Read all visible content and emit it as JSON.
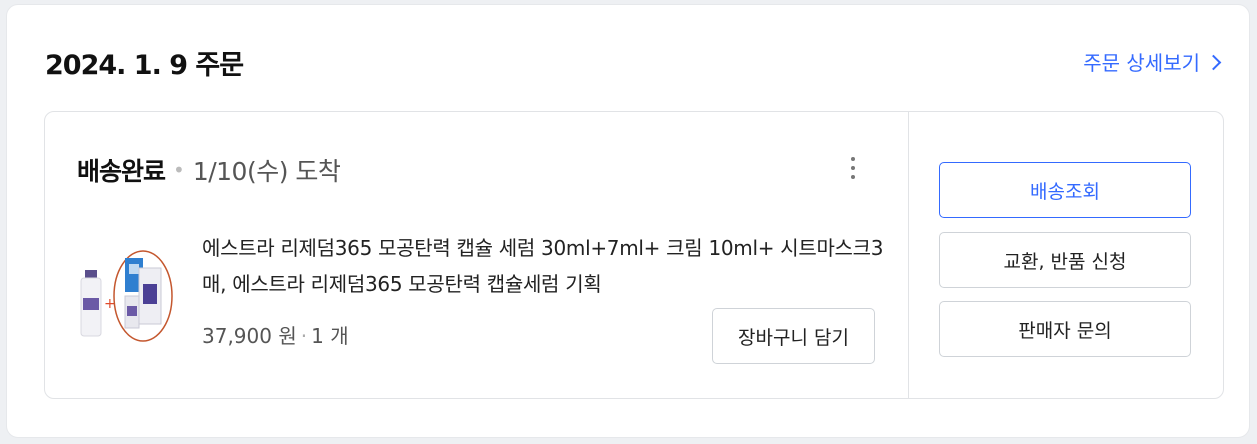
{
  "order": {
    "date_title": "2024. 1. 9 주문",
    "detail_link": "주문 상세보기",
    "status": "배송완료",
    "arrival": "1/10(수) 도착",
    "product": {
      "name": "에스트라 리제덤365 모공탄력 캡슐 세럼 30ml+7ml+ 크림 10ml+ 시트마스크3매, 에스트라 리제덤365 모공탄력 캡슐세럼 기획",
      "price": "37,900 원",
      "quantity": "1 개"
    },
    "cart_button": "장바구니 담기",
    "actions": {
      "track": "배송조회",
      "exchange_return": "교환, 반품 신청",
      "seller_inquiry": "판매자 문의"
    }
  },
  "colors": {
    "accent": "#346aff",
    "text": "#111111",
    "border": "#e1e3e6"
  },
  "icons": {
    "detail": "chevron-right-icon",
    "more": "kebab-menu-icon"
  }
}
